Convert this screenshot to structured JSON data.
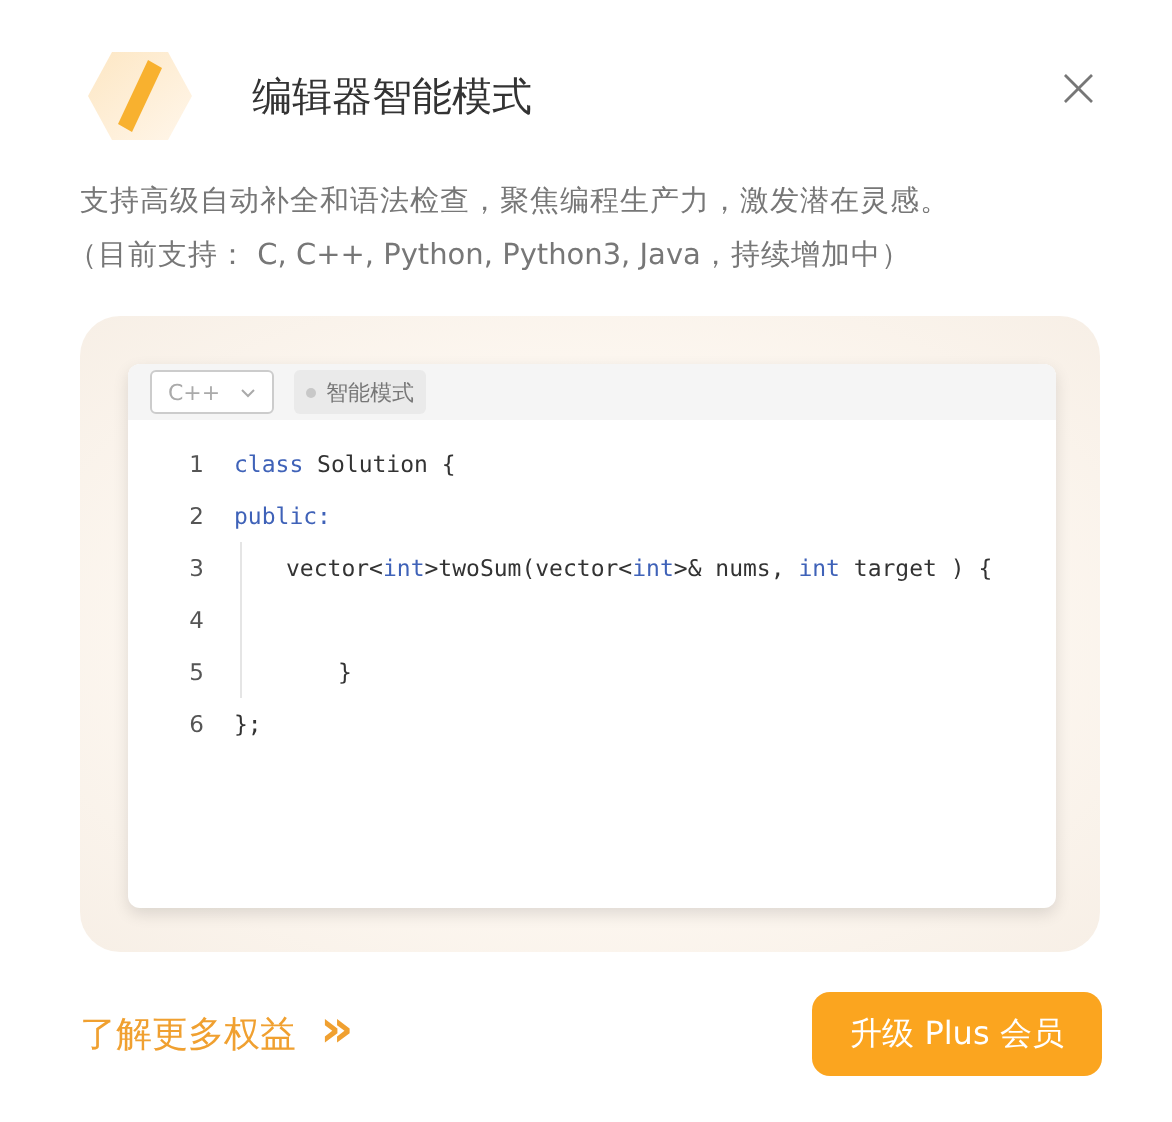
{
  "dialog": {
    "title": "编辑器智能模式",
    "close": "×"
  },
  "description": [
    "支持高级自动补全和语法检查，聚焦编程生产力，激发潜在灵感。",
    "（目前支持： C, C++, Python, Python3, Java，持续增加中）"
  ],
  "preview": {
    "language": "C++",
    "mode_chip": "智能模式",
    "lines": [
      {
        "number": "1",
        "segments": [
          {
            "kind": "keyword",
            "text": "class"
          },
          {
            "kind": "plain",
            "text": " Solution {"
          }
        ]
      },
      {
        "number": "2",
        "segments": [
          {
            "kind": "keyword",
            "text": "public:"
          }
        ],
        "children": [
          {
            "number": "3",
            "segments": [
              {
                "kind": "plain",
                "text": "vector<"
              },
              {
                "kind": "keyword",
                "text": "int"
              },
              {
                "kind": "plain",
                "text": ">twoSum(vector<"
              },
              {
                "kind": "keyword",
                "text": "int"
              },
              {
                "kind": "plain",
                "text": ">& nums, "
              },
              {
                "kind": "keyword",
                "text": "int"
              },
              {
                "kind": "plain",
                "text": " target ) {"
              }
            ],
            "children": [
              {
                "number": "4"
              },
              {
                "number": "5",
                "segments": [
                  {
                    "kind": "plain",
                    "text": "}"
                  }
                ]
              }
            ]
          }
        ]
      },
      {
        "number": "6",
        "segments": [
          {
            "kind": "plain",
            "text": "};"
          }
        ]
      }
    ]
  },
  "footer": {
    "link": "了解更多权益",
    "link_arrow": "»",
    "button": "升级 Plus 会员"
  }
}
